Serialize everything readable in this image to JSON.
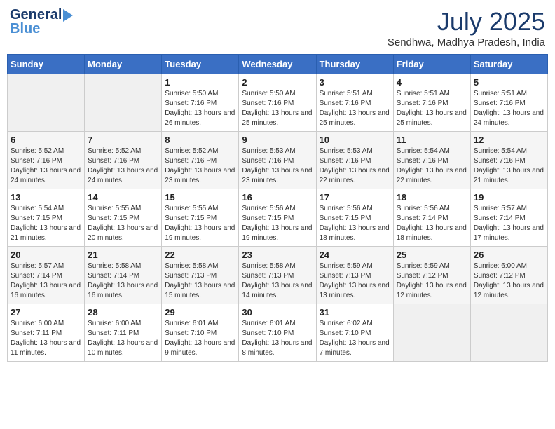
{
  "header": {
    "logo_general": "General",
    "logo_blue": "Blue",
    "month_year": "July 2025",
    "location": "Sendhwa, Madhya Pradesh, India"
  },
  "days_of_week": [
    "Sunday",
    "Monday",
    "Tuesday",
    "Wednesday",
    "Thursday",
    "Friday",
    "Saturday"
  ],
  "weeks": [
    [
      {
        "day": "",
        "info": ""
      },
      {
        "day": "",
        "info": ""
      },
      {
        "day": "1",
        "info": "Sunrise: 5:50 AM\nSunset: 7:16 PM\nDaylight: 13 hours and 26 minutes."
      },
      {
        "day": "2",
        "info": "Sunrise: 5:50 AM\nSunset: 7:16 PM\nDaylight: 13 hours and 25 minutes."
      },
      {
        "day": "3",
        "info": "Sunrise: 5:51 AM\nSunset: 7:16 PM\nDaylight: 13 hours and 25 minutes."
      },
      {
        "day": "4",
        "info": "Sunrise: 5:51 AM\nSunset: 7:16 PM\nDaylight: 13 hours and 25 minutes."
      },
      {
        "day": "5",
        "info": "Sunrise: 5:51 AM\nSunset: 7:16 PM\nDaylight: 13 hours and 24 minutes."
      }
    ],
    [
      {
        "day": "6",
        "info": "Sunrise: 5:52 AM\nSunset: 7:16 PM\nDaylight: 13 hours and 24 minutes."
      },
      {
        "day": "7",
        "info": "Sunrise: 5:52 AM\nSunset: 7:16 PM\nDaylight: 13 hours and 24 minutes."
      },
      {
        "day": "8",
        "info": "Sunrise: 5:52 AM\nSunset: 7:16 PM\nDaylight: 13 hours and 23 minutes."
      },
      {
        "day": "9",
        "info": "Sunrise: 5:53 AM\nSunset: 7:16 PM\nDaylight: 13 hours and 23 minutes."
      },
      {
        "day": "10",
        "info": "Sunrise: 5:53 AM\nSunset: 7:16 PM\nDaylight: 13 hours and 22 minutes."
      },
      {
        "day": "11",
        "info": "Sunrise: 5:54 AM\nSunset: 7:16 PM\nDaylight: 13 hours and 22 minutes."
      },
      {
        "day": "12",
        "info": "Sunrise: 5:54 AM\nSunset: 7:16 PM\nDaylight: 13 hours and 21 minutes."
      }
    ],
    [
      {
        "day": "13",
        "info": "Sunrise: 5:54 AM\nSunset: 7:15 PM\nDaylight: 13 hours and 21 minutes."
      },
      {
        "day": "14",
        "info": "Sunrise: 5:55 AM\nSunset: 7:15 PM\nDaylight: 13 hours and 20 minutes."
      },
      {
        "day": "15",
        "info": "Sunrise: 5:55 AM\nSunset: 7:15 PM\nDaylight: 13 hours and 19 minutes."
      },
      {
        "day": "16",
        "info": "Sunrise: 5:56 AM\nSunset: 7:15 PM\nDaylight: 13 hours and 19 minutes."
      },
      {
        "day": "17",
        "info": "Sunrise: 5:56 AM\nSunset: 7:15 PM\nDaylight: 13 hours and 18 minutes."
      },
      {
        "day": "18",
        "info": "Sunrise: 5:56 AM\nSunset: 7:14 PM\nDaylight: 13 hours and 18 minutes."
      },
      {
        "day": "19",
        "info": "Sunrise: 5:57 AM\nSunset: 7:14 PM\nDaylight: 13 hours and 17 minutes."
      }
    ],
    [
      {
        "day": "20",
        "info": "Sunrise: 5:57 AM\nSunset: 7:14 PM\nDaylight: 13 hours and 16 minutes."
      },
      {
        "day": "21",
        "info": "Sunrise: 5:58 AM\nSunset: 7:14 PM\nDaylight: 13 hours and 16 minutes."
      },
      {
        "day": "22",
        "info": "Sunrise: 5:58 AM\nSunset: 7:13 PM\nDaylight: 13 hours and 15 minutes."
      },
      {
        "day": "23",
        "info": "Sunrise: 5:58 AM\nSunset: 7:13 PM\nDaylight: 13 hours and 14 minutes."
      },
      {
        "day": "24",
        "info": "Sunrise: 5:59 AM\nSunset: 7:13 PM\nDaylight: 13 hours and 13 minutes."
      },
      {
        "day": "25",
        "info": "Sunrise: 5:59 AM\nSunset: 7:12 PM\nDaylight: 13 hours and 12 minutes."
      },
      {
        "day": "26",
        "info": "Sunrise: 6:00 AM\nSunset: 7:12 PM\nDaylight: 13 hours and 12 minutes."
      }
    ],
    [
      {
        "day": "27",
        "info": "Sunrise: 6:00 AM\nSunset: 7:11 PM\nDaylight: 13 hours and 11 minutes."
      },
      {
        "day": "28",
        "info": "Sunrise: 6:00 AM\nSunset: 7:11 PM\nDaylight: 13 hours and 10 minutes."
      },
      {
        "day": "29",
        "info": "Sunrise: 6:01 AM\nSunset: 7:10 PM\nDaylight: 13 hours and 9 minutes."
      },
      {
        "day": "30",
        "info": "Sunrise: 6:01 AM\nSunset: 7:10 PM\nDaylight: 13 hours and 8 minutes."
      },
      {
        "day": "31",
        "info": "Sunrise: 6:02 AM\nSunset: 7:10 PM\nDaylight: 13 hours and 7 minutes."
      },
      {
        "day": "",
        "info": ""
      },
      {
        "day": "",
        "info": ""
      }
    ]
  ]
}
